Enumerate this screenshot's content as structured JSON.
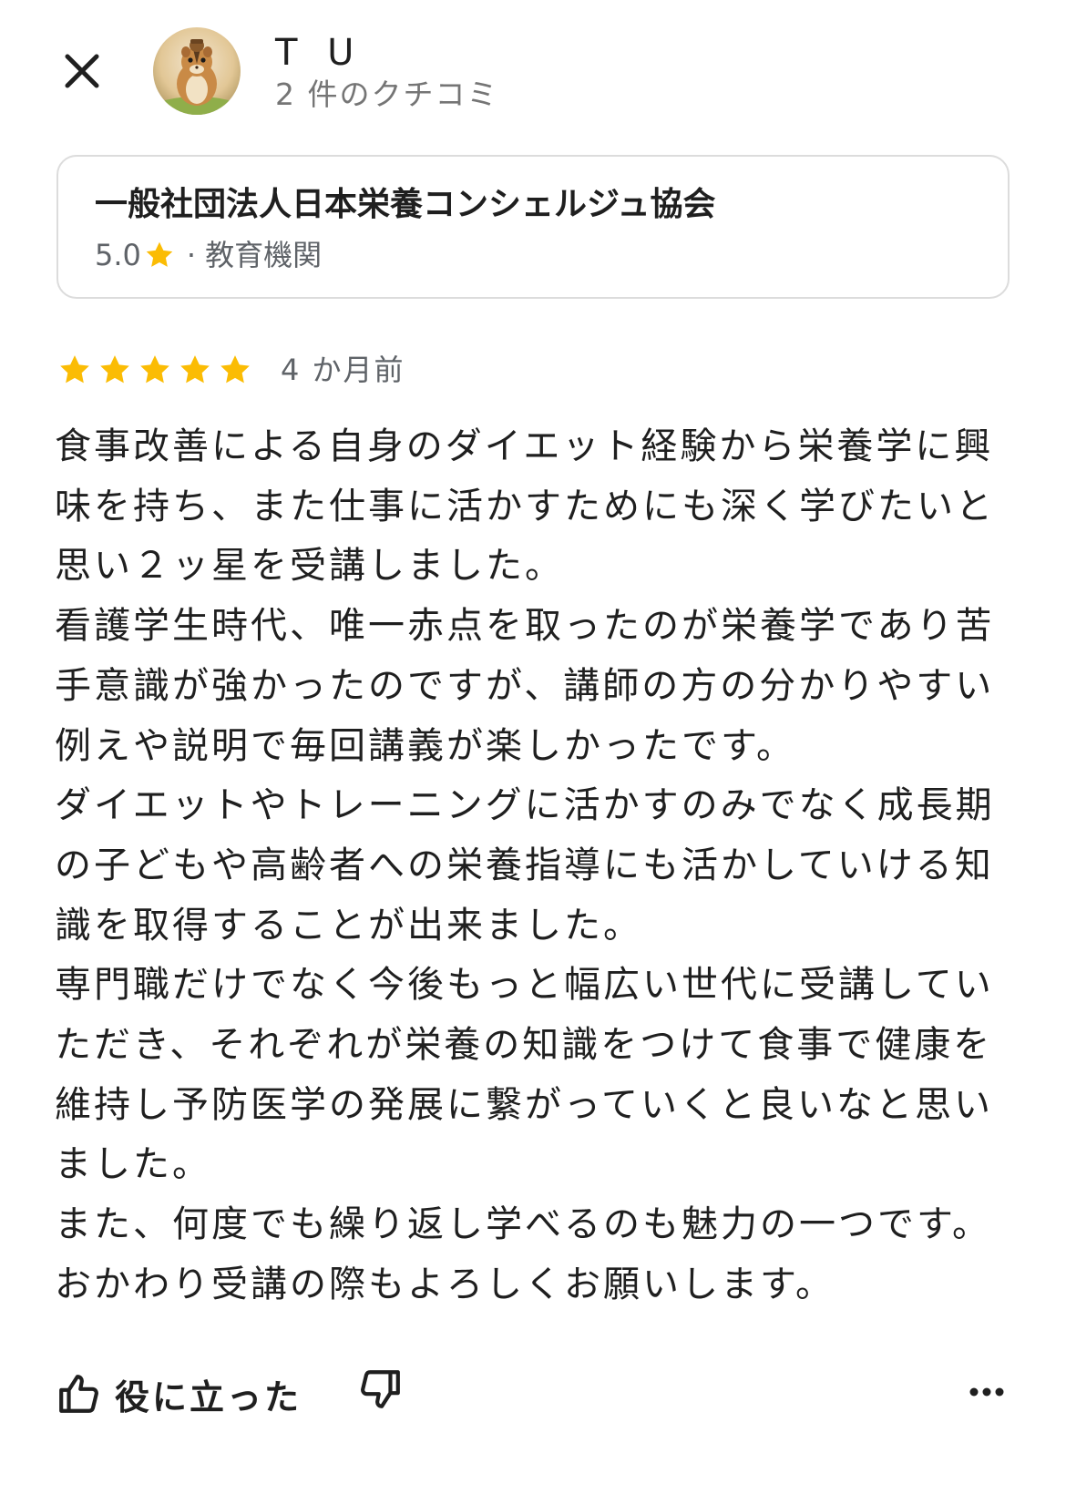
{
  "header": {
    "reviewer_name": "T U",
    "review_count": "2 件のクチコミ",
    "close_icon": "close-icon",
    "avatar_icon": "chipmunk-avatar"
  },
  "place": {
    "name": "一般社団法人日本栄養コンシェルジュ協会",
    "rating": "5.0",
    "separator": "·",
    "category": "教育機関"
  },
  "review": {
    "stars": 5,
    "time": "4 か月前",
    "paragraphs": [
      "食事改善による自身のダイエット経験から栄養学に興味を持ち、また仕事に活かすためにも深く学びたいと思い２ッ星を受講しました。",
      "看護学生時代、唯一赤点を取ったのが栄養学であり苦手意識が強かったのですが、講師の方の分かりやすい例えや説明で毎回講義が楽しかったです。",
      "ダイエットやトレーニングに活かすのみでなく成長期の子どもや高齢者への栄養指導にも活かしていける知識を取得することが出来ました。",
      "専門職だけでなく今後もっと幅広い世代に受講していただき、それぞれが栄養の知識をつけて食事で健康を維持し予防医学の発展に繋がっていくと良いなと思いました。",
      "また、何度でも繰り返し学べるのも魅力の一つです。おかわり受講の際もよろしくお願いします。"
    ]
  },
  "actions": {
    "helpful_label": "役に立った",
    "helpful_icon": "thumbs-up-icon",
    "unhelpful_icon": "thumbs-down-icon",
    "more_icon": "more-options-icon"
  },
  "colors": {
    "star": "#fbbc04",
    "text_primary": "#1f1f1f",
    "text_secondary": "#5f6368",
    "border": "#dcdcdc"
  }
}
